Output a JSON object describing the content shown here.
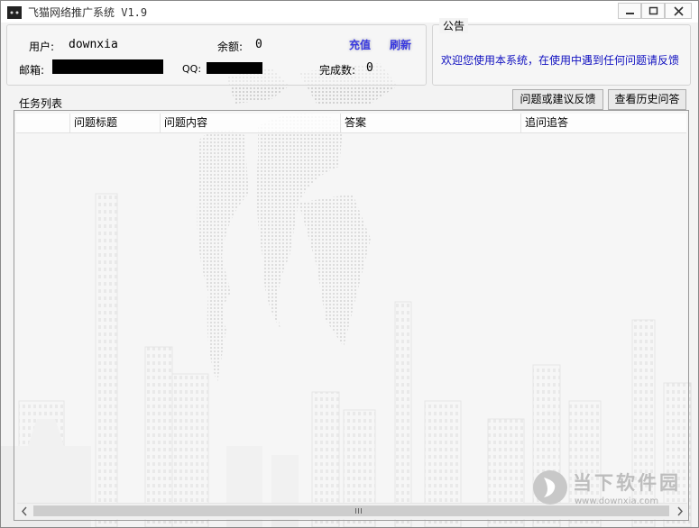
{
  "window": {
    "title": "飞猫网络推广系统 V1.9"
  },
  "user": {
    "user_label": "用户:",
    "username": "downxia",
    "balance_label": "余额:",
    "balance": "0",
    "recharge_label": "充值",
    "refresh_label": "刷新",
    "email_label": "邮箱:",
    "qq_label": "QQ:",
    "completed_label": "完成数:",
    "completed": "0"
  },
  "notice": {
    "title": "公告",
    "text": "欢迎您使用本系统，在使用中遇到任何问题请反馈"
  },
  "tasks": {
    "label": "任务列表",
    "feedback_button": "问题或建议反馈",
    "history_button": "查看历史问答",
    "columns": [
      "",
      "问题标题",
      "问题内容",
      "答案",
      "追问追答"
    ]
  },
  "watermark": {
    "brand": "当下软件园",
    "url": "www.downxia.com"
  },
  "colors": {
    "link": "#3a3ae0",
    "notice_text": "#1010c0",
    "window_bg": "#f3f3f3"
  }
}
